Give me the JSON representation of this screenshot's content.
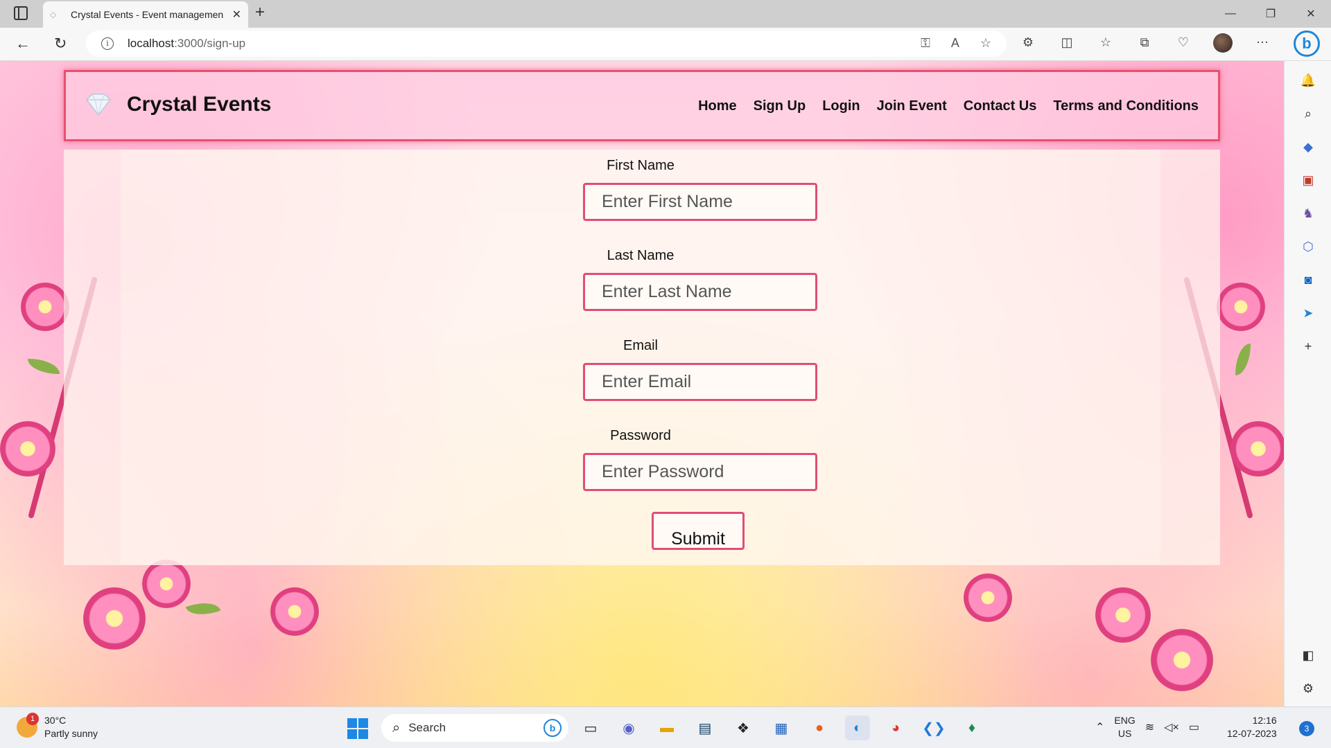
{
  "browser": {
    "tab_title": "Crystal Events - Event management",
    "tab_close": "✕",
    "new_tab": "+",
    "url_host": "localhost",
    "url_path": ":3000/sign-up",
    "window_controls": {
      "minimize": "—",
      "maximize": "❐",
      "close": "✕"
    }
  },
  "navbar": {
    "brand": "Crystal Events",
    "links": [
      "Home",
      "Sign Up",
      "Login",
      "Join Event",
      "Contact Us",
      "Terms and Conditions"
    ]
  },
  "form": {
    "first_name_label": "First Name",
    "first_name_placeholder": "Enter First Name",
    "last_name_label": "Last Name",
    "last_name_placeholder": "Enter Last Name",
    "email_label": "Email",
    "email_placeholder": "Enter Email",
    "password_label": "Password",
    "password_placeholder": "Enter Password",
    "submit_label": "Submit"
  },
  "taskbar": {
    "weather_badge": "1",
    "weather_temp": "30°C",
    "weather_desc": "Partly sunny",
    "search_label": "Search",
    "lang_line1": "ENG",
    "lang_line2": "US",
    "time": "12:16",
    "date": "12-07-2023",
    "notification_count": "3"
  },
  "colors": {
    "accent_border": "#e04d77",
    "nav_border": "#e8506f",
    "edge_blue": "#1f86d8"
  }
}
